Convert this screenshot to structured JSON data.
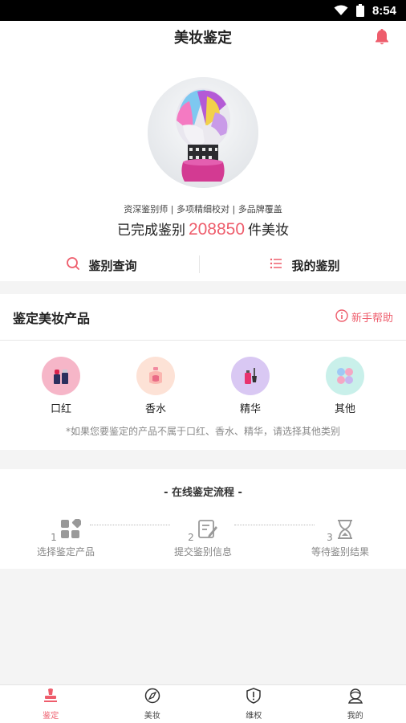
{
  "status_bar": {
    "time": "8:54"
  },
  "header": {
    "title": "美妆鉴定"
  },
  "hero": {
    "description": "资深鉴别师 | 多项精细校对 | 多品牌覆盖",
    "count_prefix": "已完成鉴别",
    "count_value": "208850",
    "count_suffix": "件美妆",
    "actions": [
      {
        "label": "鉴别查询",
        "icon": "search-icon"
      },
      {
        "label": "我的鉴别",
        "icon": "list-icon"
      }
    ]
  },
  "products": {
    "title": "鉴定美妆产品",
    "help_label": "新手帮助",
    "categories": [
      {
        "label": "口红",
        "icon": "lipstick-icon",
        "bg": "#f6b6c8"
      },
      {
        "label": "香水",
        "icon": "perfume-icon",
        "bg": "#fde2d6"
      },
      {
        "label": "精华",
        "icon": "serum-icon",
        "bg": "#d9c8f3"
      },
      {
        "label": "其他",
        "icon": "compact-icon",
        "bg": "#c9f0ea"
      }
    ],
    "note": "*如果您要鉴定的产品不属于口红、香水、精华，请选择其他类别"
  },
  "process": {
    "title": "- 在线鉴定流程 -",
    "steps": [
      {
        "number": "1",
        "label": "选择鉴定产品",
        "icon": "grid-shapes-icon"
      },
      {
        "number": "2",
        "label": "提交鉴别信息",
        "icon": "edit-document-icon"
      },
      {
        "number": "3",
        "label": "等待鉴别结果",
        "icon": "hourglass-icon"
      }
    ]
  },
  "tabbar": {
    "tabs": [
      {
        "label": "鉴定",
        "icon": "stamp-icon",
        "active": true
      },
      {
        "label": "美妆",
        "icon": "compass-icon",
        "active": false
      },
      {
        "label": "维权",
        "icon": "shield-alert-icon",
        "active": false
      },
      {
        "label": "我的",
        "icon": "user-icon",
        "active": false
      }
    ]
  },
  "colors": {
    "accent": "#ee5d6c",
    "background": "#f4f4f4"
  }
}
